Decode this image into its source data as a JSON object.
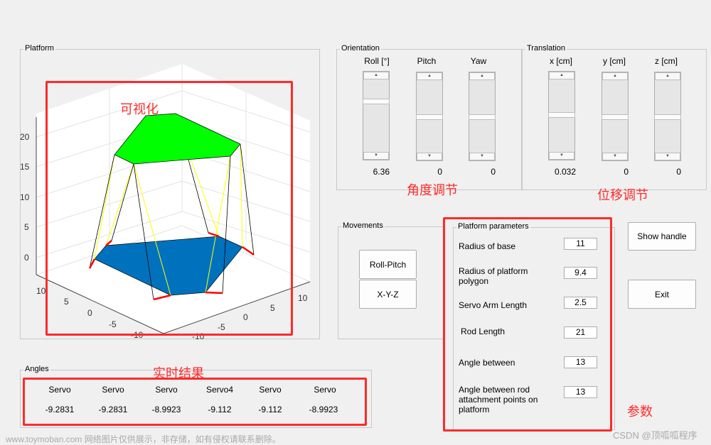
{
  "platform_panel": {
    "title": "Platform",
    "z_ticks": [
      "20",
      "15",
      "10",
      "5",
      "0"
    ],
    "x_ticks": [
      "10",
      "5",
      "0",
      "-5",
      "-10"
    ],
    "y_ticks": [
      "10",
      "5",
      "0",
      "-5",
      "-10"
    ],
    "colors": {
      "top": "#00ff00",
      "base": "#0072bd",
      "arms": "#ff0000",
      "rods": "#000000",
      "legs": "#ffff00"
    }
  },
  "orientation": {
    "title": "Orientation",
    "sliders": [
      {
        "label": "Roll [°]",
        "value": "6.36"
      },
      {
        "label": "Pitch",
        "value": "0"
      },
      {
        "label": "Yaw",
        "value": "0"
      }
    ]
  },
  "translation": {
    "title": "Translation",
    "sliders": [
      {
        "label": "x [cm]",
        "value": "0.032"
      },
      {
        "label": "y [cm]",
        "value": "0"
      },
      {
        "label": "z [cm]",
        "value": "0"
      }
    ]
  },
  "movements": {
    "title": "Movements",
    "buttons": [
      "Roll-Pitch",
      "X-Y-Z"
    ]
  },
  "params": {
    "title": "Platform parameters",
    "items": [
      {
        "label": "Radius of base",
        "value": "11"
      },
      {
        "label": "Radius of platform polygon",
        "value": "9.4"
      },
      {
        "label": "Servo Arm Length",
        "value": "2.5"
      },
      {
        "label": "Rod Length",
        "value": "21"
      },
      {
        "label": "Angle between",
        "value": "13"
      },
      {
        "label": "Angle between rod attachment points on platform",
        "value": "13"
      }
    ]
  },
  "buttons": {
    "show_handle": "Show handle",
    "exit": "Exit"
  },
  "angles": {
    "title": "Angles",
    "headers": [
      "Servo",
      "Servo",
      "Servo",
      "Servo4",
      "Servo",
      "Servo"
    ],
    "values": [
      "-9.2831",
      "-9.2831",
      "-8.9923",
      "-9.112",
      "-9.112",
      "-8.9923"
    ]
  },
  "annotations": {
    "visual": "可视化",
    "angle_adjust": "角度调节",
    "translation_adjust": "位移调节",
    "realtime": "实时结果",
    "params": "参数",
    "annotation_color": "#ff2a2a"
  },
  "watermarks": {
    "left": "www.toymoban.com 网络图片仅供展示，非存储，如有侵权请联系删除。",
    "right": "CSDN @顶呱呱程序"
  }
}
